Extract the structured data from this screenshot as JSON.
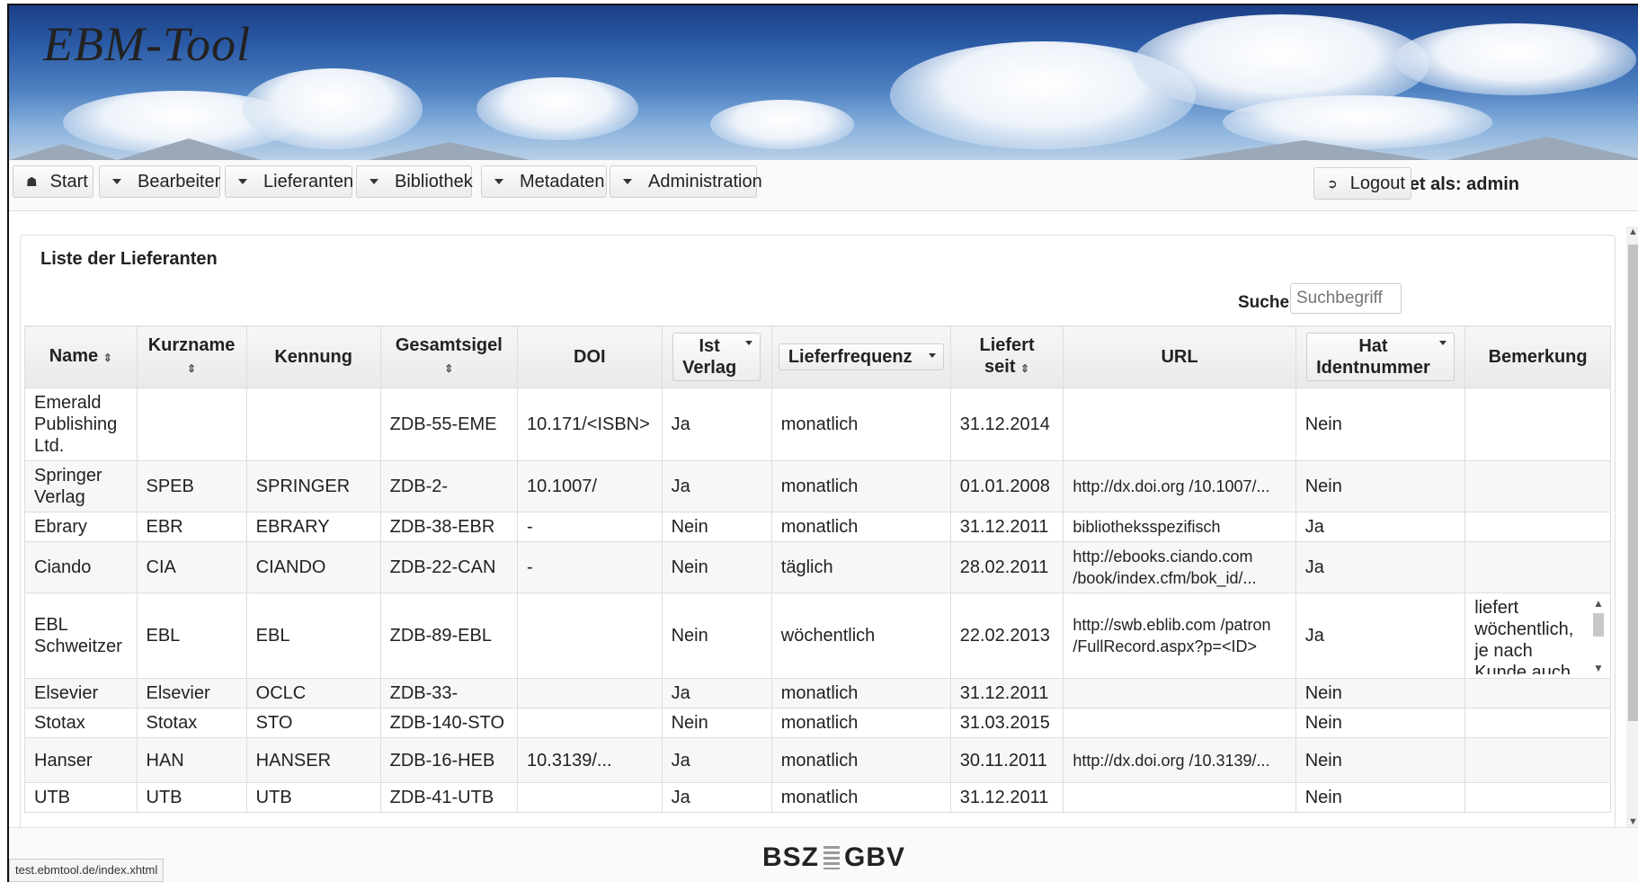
{
  "app": {
    "title": "EBM-Tool"
  },
  "nav": {
    "start": "Start",
    "bearbeiter": "Bearbeiter",
    "lieferanten": "Lieferanten",
    "bibliothek": "Bibliothek",
    "metadaten": "Metadaten",
    "administration": "Administration",
    "logged_in": "Angemeldet als: admin",
    "logout": "Logout"
  },
  "panel": {
    "title": "Liste der Lieferanten",
    "search_label": "Suchen:",
    "search_placeholder": "Suchbegriff"
  },
  "table": {
    "headers": {
      "name": "Name",
      "kurzname": "Kurzname",
      "kennung": "Kennung",
      "gesamtsigel": "Gesamtsigel",
      "doi": "DOI",
      "ist_verlag_1": "Ist",
      "ist_verlag_2": "Verlag",
      "lieferfrequenz": "Lieferfrequenz",
      "liefert_seit_1": "Liefert",
      "liefert_seit_2": "seit",
      "url": "URL",
      "hat_ident_1": "Hat",
      "hat_ident_2": "Identnummer",
      "bemerkung": "Bemerkung"
    },
    "rows": [
      {
        "name": "Emerald Publishing Ltd.",
        "kurzname": "",
        "kennung": "",
        "gesamtsigel": "ZDB-55-EME",
        "doi": "10.171/<ISBN>",
        "ist_verlag": "Ja",
        "lieferfrequenz": "monatlich",
        "liefert_seit": "31.12.2014",
        "url": "",
        "hat_ident": "Nein",
        "bemerkung": ""
      },
      {
        "name": "Springer Verlag",
        "kurzname": "SPEB",
        "kennung": "SPRINGER",
        "gesamtsigel": "ZDB-2-",
        "doi": "10.1007/",
        "ist_verlag": "Ja",
        "lieferfrequenz": "monatlich",
        "liefert_seit": "01.01.2008",
        "url": "http://dx.doi.org /10.1007/...",
        "hat_ident": "Nein",
        "bemerkung": ""
      },
      {
        "name": "Ebrary",
        "kurzname": "EBR",
        "kennung": "EBRARY",
        "gesamtsigel": "ZDB-38-EBR",
        "doi": "-",
        "ist_verlag": "Nein",
        "lieferfrequenz": "monatlich",
        "liefert_seit": "31.12.2011",
        "url": "bibliotheksspezifisch",
        "hat_ident": "Ja",
        "bemerkung": ""
      },
      {
        "name": "Ciando",
        "kurzname": "CIA",
        "kennung": "CIANDO",
        "gesamtsigel": "ZDB-22-CAN",
        "doi": "-",
        "ist_verlag": "Nein",
        "lieferfrequenz": "täglich",
        "liefert_seit": "28.02.2011",
        "url": "http://ebooks.ciando.com /book/index.cfm/bok_id/...",
        "hat_ident": "Ja",
        "bemerkung": ""
      },
      {
        "name": "EBL Schweitzer",
        "kurzname": "EBL",
        "kennung": "EBL",
        "gesamtsigel": "ZDB-89-EBL",
        "doi": "",
        "ist_verlag": "Nein",
        "lieferfrequenz": "wöchentlich",
        "liefert_seit": "22.02.2013",
        "url": "http://swb.eblib.com /patron /FullRecord.aspx?p=<ID>",
        "hat_ident": "Ja",
        "bemerkung": "liefert wöchentlich, je nach Kunde auch"
      },
      {
        "name": "Elsevier",
        "kurzname": "Elsevier",
        "kennung": "OCLC",
        "gesamtsigel": "ZDB-33-",
        "doi": "",
        "ist_verlag": "Ja",
        "lieferfrequenz": "monatlich",
        "liefert_seit": "31.12.2011",
        "url": "",
        "hat_ident": "Nein",
        "bemerkung": ""
      },
      {
        "name": "Stotax",
        "kurzname": "Stotax",
        "kennung": "STO",
        "gesamtsigel": "ZDB-140-STO",
        "doi": "",
        "ist_verlag": "Nein",
        "lieferfrequenz": "monatlich",
        "liefert_seit": "31.03.2015",
        "url": "",
        "hat_ident": "Nein",
        "bemerkung": ""
      },
      {
        "name": "Hanser",
        "kurzname": "HAN",
        "kennung": "HANSER",
        "gesamtsigel": "ZDB-16-HEB",
        "doi": "10.3139/...",
        "ist_verlag": "Ja",
        "lieferfrequenz": "monatlich",
        "liefert_seit": "30.11.2011",
        "url": "http://dx.doi.org /10.3139/...",
        "hat_ident": "Nein",
        "bemerkung": ""
      },
      {
        "name": "UTB",
        "kurzname": "UTB",
        "kennung": "UTB",
        "gesamtsigel": "ZDB-41-UTB",
        "doi": "",
        "ist_verlag": "Ja",
        "lieferfrequenz": "monatlich",
        "liefert_seit": "31.12.2011",
        "url": "",
        "hat_ident": "Nein",
        "bemerkung": ""
      }
    ]
  },
  "footer": {
    "logo_left": "BSZ",
    "logo_right": "GBV"
  },
  "status": {
    "url": "test.ebmtool.de/index.xhtml"
  }
}
